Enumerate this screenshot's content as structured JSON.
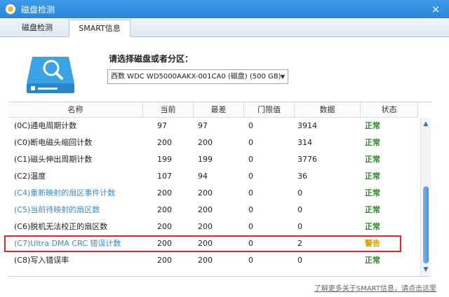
{
  "window": {
    "title": "磁盘检测",
    "close_label": "×"
  },
  "tabs": [
    {
      "label": "磁盘检测"
    },
    {
      "label": "SMART信息"
    }
  ],
  "selector": {
    "label": "请选择磁盘或者分区：",
    "value": "西数 WDC WD5000AAKX-001CA0 (磁盘)  (500 GB)"
  },
  "table": {
    "headers": [
      "名称",
      "当前",
      "最差",
      "门限值",
      "数据",
      "状态"
    ],
    "rows": [
      {
        "name": "(0C)通电周期计数",
        "current": "97",
        "worst": "97",
        "threshold": "0",
        "data": "3914",
        "status": "正常"
      },
      {
        "name": "(C0)断电磁头缩回计数",
        "current": "200",
        "worst": "200",
        "threshold": "0",
        "data": "314",
        "status": "正常"
      },
      {
        "name": "(C1)磁头伸出周期计数",
        "current": "199",
        "worst": "199",
        "threshold": "0",
        "data": "3776",
        "status": "正常"
      },
      {
        "name": "(C2)温度",
        "current": "107",
        "worst": "94",
        "threshold": "0",
        "data": "36",
        "status": "正常"
      },
      {
        "name": "(C4)重新映射的扇区事件计数",
        "current": "200",
        "worst": "200",
        "threshold": "0",
        "data": "0",
        "status": "正常"
      },
      {
        "name": "(C5)当前待映射的扇区数",
        "current": "200",
        "worst": "200",
        "threshold": "0",
        "data": "0",
        "status": "正常"
      },
      {
        "name": "(C6)脱机无法校正的扇区数",
        "current": "200",
        "worst": "200",
        "threshold": "0",
        "data": "0",
        "status": "正常"
      },
      {
        "name": "(C7)Ultra DMA CRC 错误计数",
        "current": "200",
        "worst": "200",
        "threshold": "0",
        "data": "2",
        "status": "警告"
      },
      {
        "name": "(C8)写入错误率",
        "current": "200",
        "worst": "200",
        "threshold": "0",
        "data": "0",
        "status": "正常"
      }
    ]
  },
  "footer": {
    "link": "了解更多关于SMART信息，请点击这里"
  },
  "colors": {
    "accent": "#2b84d6",
    "ok": "#2a8f2a",
    "warn": "#d9a000",
    "highlight": "#e0262a",
    "link": "#3b8bc8"
  }
}
